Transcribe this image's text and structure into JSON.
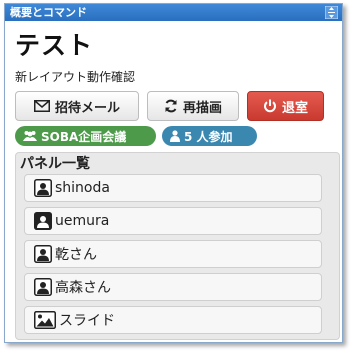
{
  "window": {
    "title": "概要とコマンド"
  },
  "header": {
    "title": "テスト",
    "subtitle": "新レイアウト動作確認"
  },
  "buttons": {
    "invite": "招待メール",
    "redraw": "再描画",
    "leave": "退室"
  },
  "badges": {
    "meeting": "SOBA企画会議",
    "participants": "5 人参加"
  },
  "panel": {
    "title": "パネル一覧",
    "items": [
      {
        "label": "shinoda",
        "icon": "user-icon"
      },
      {
        "label": "uemura",
        "icon": "user-icon"
      },
      {
        "label": "乾さん",
        "icon": "user-icon"
      },
      {
        "label": "高森さん",
        "icon": "user-icon"
      },
      {
        "label": "スライド",
        "icon": "image-icon"
      }
    ]
  },
  "colors": {
    "titlebar": "#2a6fbf",
    "leave_button": "#c93a2f",
    "meeting_badge": "#4d9a4a",
    "count_badge": "#3a87b0"
  }
}
